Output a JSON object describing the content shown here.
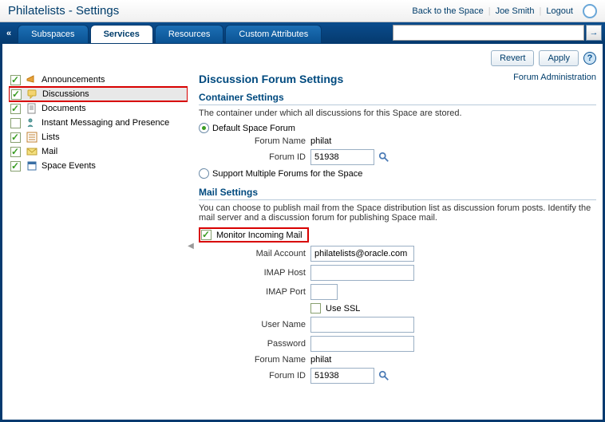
{
  "header": {
    "title": "Philatelists - Settings",
    "links": {
      "back": "Back to the Space",
      "user": "Joe Smith",
      "logout": "Logout"
    }
  },
  "tabs": {
    "subspaces": "Subspaces",
    "services": "Services",
    "resources": "Resources",
    "custom": "Custom Attributes"
  },
  "search": {
    "placeholder": ""
  },
  "buttons": {
    "revert": "Revert",
    "apply": "Apply"
  },
  "sidebar": {
    "items": [
      {
        "label": "Announcements",
        "checked": true,
        "icon": "megaphone"
      },
      {
        "label": "Discussions",
        "checked": true,
        "icon": "chat",
        "selected": true
      },
      {
        "label": "Documents",
        "checked": true,
        "icon": "doc"
      },
      {
        "label": "Instant Messaging and Presence",
        "checked": false,
        "icon": "im"
      },
      {
        "label": "Lists",
        "checked": true,
        "icon": "list"
      },
      {
        "label": "Mail",
        "checked": true,
        "icon": "mail"
      },
      {
        "label": "Space Events",
        "checked": true,
        "icon": "calendar"
      }
    ]
  },
  "main": {
    "title": "Discussion Forum Settings",
    "admin_link": "Forum Administration",
    "container": {
      "head": "Container Settings",
      "desc": "The container under which all discussions for this Space are stored.",
      "opt1": "Default Space Forum",
      "opt2": "Support Multiple Forums for the Space",
      "forum_name_label": "Forum Name",
      "forum_name": "philat",
      "forum_id_label": "Forum ID",
      "forum_id": "51938"
    },
    "mail": {
      "head": "Mail Settings",
      "desc": "You can choose to publish mail from the Space distribution list as discussion forum posts. Identify the mail server and a discussion forum for publishing Space mail.",
      "monitor": "Monitor Incoming Mail",
      "account_label": "Mail Account",
      "account": "philatelists@oracle.com",
      "imap_host_label": "IMAP Host",
      "imap_host": "",
      "imap_port_label": "IMAP Port",
      "imap_port": "",
      "use_ssl": "Use SSL",
      "user_label": "User Name",
      "user": "",
      "pass_label": "Password",
      "pass": "",
      "forum_name_label": "Forum Name",
      "forum_name": "philat",
      "forum_id_label": "Forum ID",
      "forum_id": "51938"
    }
  }
}
